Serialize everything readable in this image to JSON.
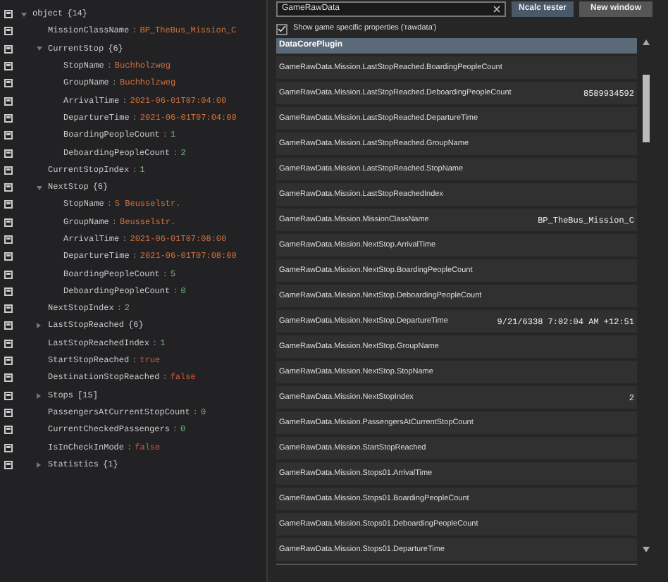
{
  "tree": [
    {
      "key": "object",
      "summary": "{14}",
      "expanded": true,
      "children": [
        {
          "key": "MissionClassName",
          "sep": ":",
          "value": "BP_TheBus_Mission_C",
          "kind": "string"
        },
        {
          "key": "CurrentStop",
          "summary": "{6}",
          "expanded": true,
          "children": [
            {
              "key": "StopName",
              "sep": ":",
              "value": "Buchholzweg",
              "kind": "string"
            },
            {
              "key": "GroupName",
              "sep": ":",
              "value": "Buchholzweg",
              "kind": "string"
            },
            {
              "key": "ArrivalTime",
              "sep": ":",
              "value": "2021-06-01T07:04:00",
              "kind": "string"
            },
            {
              "key": "DepartureTime",
              "sep": ":",
              "value": "2021-06-01T07:04:00",
              "kind": "string"
            },
            {
              "key": "BoardingPeopleCount",
              "sep": ":",
              "value": "1",
              "kind": "number"
            },
            {
              "key": "DeboardingPeopleCount",
              "sep": ":",
              "value": "2",
              "kind": "number"
            }
          ]
        },
        {
          "key": "CurrentStopIndex",
          "sep": ":",
          "value": "1",
          "kind": "number"
        },
        {
          "key": "NextStop",
          "summary": "{6}",
          "expanded": true,
          "children": [
            {
              "key": "StopName",
              "sep": ":",
              "value": "S Beusselstr.",
              "kind": "string"
            },
            {
              "key": "GroupName",
              "sep": ":",
              "value": "Beusselstr.",
              "kind": "string"
            },
            {
              "key": "ArrivalTime",
              "sep": ":",
              "value": "2021-06-01T07:08:00",
              "kind": "string"
            },
            {
              "key": "DepartureTime",
              "sep": ":",
              "value": "2021-06-01T07:08:00",
              "kind": "string"
            },
            {
              "key": "BoardingPeopleCount",
              "sep": ":",
              "value": "5",
              "kind": "number"
            },
            {
              "key": "DeboardingPeopleCount",
              "sep": ":",
              "value": "0",
              "kind": "number"
            }
          ]
        },
        {
          "key": "NextStopIndex",
          "sep": ":",
          "value": "2",
          "kind": "number"
        },
        {
          "key": "LastStopReached",
          "summary": "{6}",
          "expanded": false
        },
        {
          "key": "LastStopReachedIndex",
          "sep": ":",
          "value": "1",
          "kind": "number"
        },
        {
          "key": "StartStopReached",
          "sep": ":",
          "value": "true",
          "kind": "boolean"
        },
        {
          "key": "DestinationStopReached",
          "sep": ":",
          "value": "false",
          "kind": "boolean"
        },
        {
          "key": "Stops",
          "summary": "[15]",
          "expanded": false
        },
        {
          "key": "PassengersAtCurrentStopCount",
          "sep": ":",
          "value": "0",
          "kind": "number"
        },
        {
          "key": "CurrentCheckedPassengers",
          "sep": ":",
          "value": "0",
          "kind": "number"
        },
        {
          "key": "IsInCheckInMode",
          "sep": ":",
          "value": "false",
          "kind": "boolean"
        },
        {
          "key": "Statistics",
          "summary": "{1}",
          "expanded": false
        }
      ]
    }
  ],
  "search": {
    "value": "GameRawData"
  },
  "buttons": [
    "Ncalc tester",
    "New window"
  ],
  "option": {
    "label": "Show game specific properties ('rawdata')",
    "checked": true
  },
  "group_header": "DataCorePlugin",
  "properties": [
    {
      "name": "GameRawData.Mission.LastStopReached.BoardingPeopleCount"
    },
    {
      "name": "GameRawData.Mission.LastStopReached.DeboardingPeopleCount",
      "value": "8589934592"
    },
    {
      "name": "GameRawData.Mission.LastStopReached.DepartureTime"
    },
    {
      "name": "GameRawData.Mission.LastStopReached.GroupName"
    },
    {
      "name": "GameRawData.Mission.LastStopReached.StopName"
    },
    {
      "name": "GameRawData.Mission.LastStopReachedIndex"
    },
    {
      "name": "GameRawData.Mission.MissionClassName",
      "value": "BP_TheBus_Mission_C"
    },
    {
      "name": "GameRawData.Mission.NextStop.ArrivalTime"
    },
    {
      "name": "GameRawData.Mission.NextStop.BoardingPeopleCount"
    },
    {
      "name": "GameRawData.Mission.NextStop.DeboardingPeopleCount"
    },
    {
      "name": "GameRawData.Mission.NextStop.DepartureTime",
      "value": "9/21/6338 7:02:04 AM +12:51"
    },
    {
      "name": "GameRawData.Mission.NextStop.GroupName"
    },
    {
      "name": "GameRawData.Mission.NextStop.StopName"
    },
    {
      "name": "GameRawData.Mission.NextStopIndex",
      "value": "2"
    },
    {
      "name": "GameRawData.Mission.PassengersAtCurrentStopCount"
    },
    {
      "name": "GameRawData.Mission.StartStopReached"
    },
    {
      "name": "GameRawData.Mission.Stops01.ArrivalTime"
    },
    {
      "name": "GameRawData.Mission.Stops01.BoardingPeopleCount"
    },
    {
      "name": "GameRawData.Mission.Stops01.DeboardingPeopleCount"
    },
    {
      "name": "GameRawData.Mission.Stops01.DepartureTime"
    }
  ]
}
